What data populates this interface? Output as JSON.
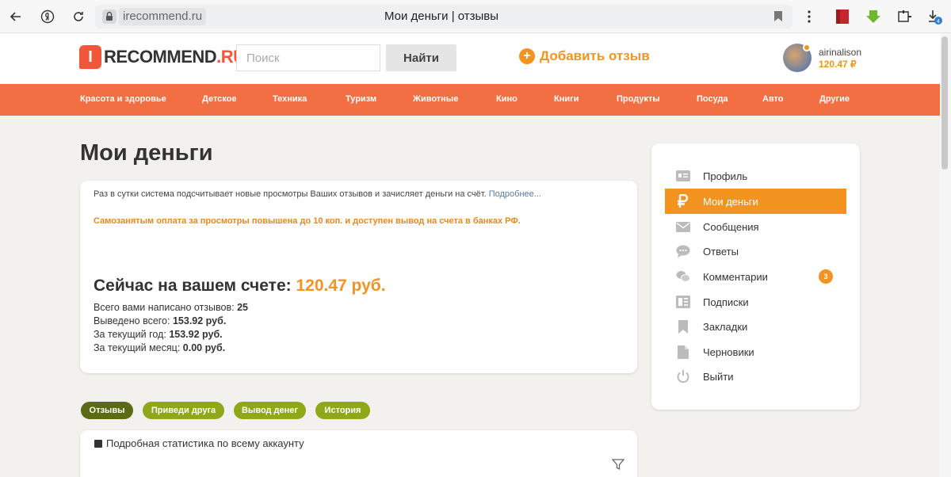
{
  "browser": {
    "url": "irecommend.ru",
    "title": "Мои деньги | отзывы",
    "download_badge": "4"
  },
  "header": {
    "logo_prefix": "RECOMMEND",
    "logo_suffix": ".RU",
    "logo_letter": "I",
    "search_placeholder": "Поиск",
    "search_button": "Найти",
    "add_review": "Добавить отзыв",
    "username": "airinalison",
    "balance": "120.47 ₽"
  },
  "nav": [
    "Красота и здоровье",
    "Детское",
    "Техника",
    "Туризм",
    "Животные",
    "Кино",
    "Книги",
    "Продукты",
    "Посуда",
    "Авто",
    "Другие"
  ],
  "page": {
    "title": "Мои деньги",
    "info_text": "Раз в сутки система подсчитывает новые просмотры Ваших отзывов и зачисляет деньги на счёт.",
    "info_link": "Подробнее...",
    "promo": "Самозанятым оплата за просмотры повышена до 10 коп. и доступен вывод на счета в банках РФ.",
    "balance_label": "Сейчас на вашем счете:",
    "balance_value": "120.47 руб.",
    "stats": [
      {
        "label": "Всего вами написано отзывов:",
        "value": "25"
      },
      {
        "label": "Выведено всего:",
        "value": "153.92 руб."
      },
      {
        "label": "За текущий год:",
        "value": "153.92 руб."
      },
      {
        "label": "За текущий месяц:",
        "value": "0.00 руб."
      }
    ],
    "tabs": [
      "Отзывы",
      "Приведи друга",
      "Вывод денег",
      "История"
    ],
    "stats_link": "Подробная статистика по всему аккаунту"
  },
  "sidebar": [
    {
      "label": "Профиль",
      "icon": "profile-icon"
    },
    {
      "label": "Мои деньги",
      "icon": "ruble-icon",
      "active": true
    },
    {
      "label": "Сообщения",
      "icon": "mail-icon"
    },
    {
      "label": "Ответы",
      "icon": "chat-icon"
    },
    {
      "label": "Комментарии",
      "icon": "comments-icon",
      "badge": "3"
    },
    {
      "label": "Подписки",
      "icon": "subscriptions-icon"
    },
    {
      "label": "Закладки",
      "icon": "bookmark-icon"
    },
    {
      "label": "Черновики",
      "icon": "draft-icon"
    },
    {
      "label": "Выйти",
      "icon": "power-icon"
    }
  ],
  "colors": {
    "accent": "#f39320",
    "nav": "#f26f43",
    "logo": "#f2573a",
    "tab_active": "#5a6b14",
    "tab": "#8fa81a"
  }
}
